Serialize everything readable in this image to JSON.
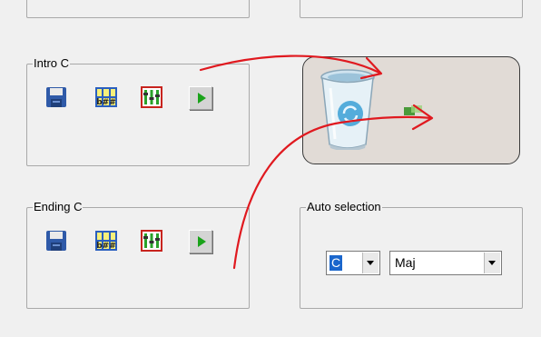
{
  "groups": {
    "intro": {
      "label": "Intro C"
    },
    "ending": {
      "label": "Ending C"
    },
    "auto_selection": {
      "label": "Auto selection",
      "key_value": "C",
      "mode_value": "Maj"
    }
  },
  "icons": {
    "save": "floppy-disk-icon",
    "chords": "chord-grid-icon",
    "mixer": "mixer-sliders-icon",
    "play": "play-icon",
    "trash": "recycle-bin-icon"
  },
  "annotation_color": "#e0191f"
}
